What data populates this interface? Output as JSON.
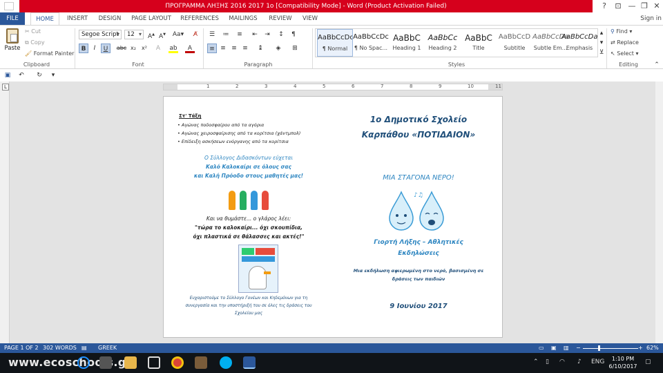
{
  "window": {
    "title": "ΠΡΟΓΡΑΜΜΑ ΛΗΞΗΣ 2016 2017 1o [Compatibility Mode] - Word (Product Activation Failed)",
    "help": "?",
    "restore": "⊡",
    "minimize": "—",
    "maximize": "❐",
    "close": "✕"
  },
  "tabs": [
    "FILE",
    "HOME",
    "INSERT",
    "DESIGN",
    "PAGE LAYOUT",
    "REFERENCES",
    "MAILINGS",
    "REVIEW",
    "VIEW"
  ],
  "signin": "Sign in",
  "clipboard": {
    "paste": "Paste",
    "cut": "Cut",
    "copy": "Copy",
    "format_painter": "Format Painter",
    "label": "Clipboard"
  },
  "font": {
    "name": "Segoe Script",
    "size": "12",
    "label": "Font",
    "bold": "B",
    "italic": "I",
    "underline": "U",
    "strike": "abc",
    "sub": "x₂",
    "sup": "x²"
  },
  "paragraph": {
    "label": "Paragraph",
    "pilcrow": "¶"
  },
  "styles": {
    "label": "Styles",
    "items": [
      {
        "sample": "AaBbCcDc",
        "name": "¶ Normal"
      },
      {
        "sample": "AaBbCcDc",
        "name": "¶ No Spac..."
      },
      {
        "sample": "AaBbC",
        "name": "Heading 1"
      },
      {
        "sample": "AaBbCc",
        "name": "Heading 2"
      },
      {
        "sample": "AaBbC",
        "name": "Title"
      },
      {
        "sample": "AaBbCcD",
        "name": "Subtitle"
      },
      {
        "sample": "AaBbCcDa",
        "name": "Subtle Em..."
      },
      {
        "sample": "AaBbCcDa",
        "name": "Emphasis"
      }
    ]
  },
  "editing": {
    "label": "Editing",
    "find": "Find",
    "replace": "Replace",
    "select": "Select"
  },
  "ruler": {
    "numbers": [
      "1",
      "2",
      "3",
      "4",
      "5",
      "6",
      "7",
      "8",
      "9",
      "10",
      "11"
    ]
  },
  "document": {
    "left": {
      "heading": "Στ' Τάξη",
      "bullets": [
        "Αγώνας ποδοσφαίρου από τα αγόρια",
        "Αγώνας χειροσφαίρισης από τα κορίτσια (χάντμπολ)",
        "Επίδειξη ασκήσεων ενόργανης από τα κορίτσια"
      ],
      "greeting": [
        "Ο Σύλλογος Διδασκόντων εύχεται",
        "Καλό Καλοκαίρι σε όλους σας",
        "και Καλή Πρόοδο στους μαθητές μας!"
      ],
      "reminder": [
        "Και να θυμάστε... ο γλάρος λέει:",
        "\"τώρα το καλοκαίρι... όχι σκουπίδια,",
        "όχι πλαστικά σε θάλασσες και ακτές!\""
      ],
      "thanks": [
        "Ευχαριστούμε το Σύλλογο Γονέων και Κηδεμόνων για τη",
        "συνεργασία και την υποστήριξή του σε όλες τις δράσεις του",
        "Σχολείου μας"
      ]
    },
    "right": {
      "school_line1": "1ο Δημοτικό Σχολείο",
      "school_line2": "Καρπάθου «ΠΟΤΙΔΑΙΟΝ»",
      "theme": "ΜΙΑ ΣΤΑΓΟΝΑ ΝΕΡΟ!",
      "event_line1": "Γιορτή Λήξης – Αθλητικές",
      "event_line2": "Εκδηλώσεις",
      "desc_line1": "Μια εκδήλωση αφιερωμένη στο νερό, βασισμένη σε",
      "desc_line2": "δράσεις των παιδιών",
      "date": "9 Ιουνίου 2017"
    }
  },
  "status": {
    "page": "PAGE 1 OF 2",
    "words": "302 WORDS",
    "language": "GREEK",
    "zoom": "62%"
  },
  "taskbar": {
    "watermark": "www.ecoschools.gr",
    "lang": "ENG",
    "time": "1:10 PM",
    "date": "6/10/2017"
  },
  "colors": {
    "word_blue": "#2b579a",
    "title_red": "#d6001c",
    "heading_blue": "#1f4e79",
    "accent_blue": "#2e86c1"
  }
}
